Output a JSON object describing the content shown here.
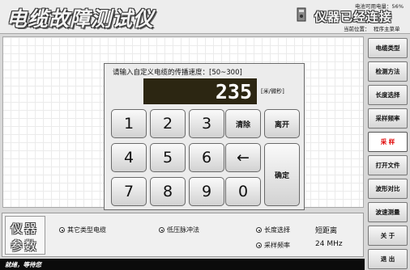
{
  "app": {
    "title": "电缆故障测试仪",
    "battery": "电池可用电量：56%",
    "connection_status": "仪器已经连接",
    "location_label": "当前位置：",
    "location_value": "程序主菜单"
  },
  "dialog": {
    "prompt": "请输入自定义电缆的传播速度：[50~300]",
    "value": "235",
    "unit": "[米/微秒]",
    "keys": {
      "k1": "1",
      "k2": "2",
      "k3": "3",
      "k4": "4",
      "k5": "5",
      "k6": "6",
      "k7": "7",
      "k8": "8",
      "k9": "9",
      "k0": "0",
      "clear": "清除",
      "exit": "离开",
      "backspace": "←",
      "confirm": "确定"
    }
  },
  "menu": [
    {
      "label": "电缆类型",
      "active": false
    },
    {
      "label": "检测方法",
      "active": false
    },
    {
      "label": "长度选择",
      "active": false
    },
    {
      "label": "采样频率",
      "active": false
    },
    {
      "label": "采  样",
      "active": true
    },
    {
      "label": "打开文件",
      "active": false
    },
    {
      "label": "波形对比",
      "active": false
    },
    {
      "label": "波速测量",
      "active": false
    },
    {
      "label": "关  于",
      "active": false
    },
    {
      "label": "退  出",
      "active": false
    }
  ],
  "params": {
    "title_line1": "仪器",
    "title_line2": "参数",
    "cable_type": "其它类型电缆",
    "method": "低压脉冲法",
    "length_label": "长度选择",
    "length_value": "短距离",
    "sample_label": "采样频率",
    "sample_value": "24 MHz"
  },
  "status": {
    "text": "就绪，等待您"
  },
  "colors": {
    "active_menu_text": "#e00000",
    "display_bg": "#2c2612"
  }
}
